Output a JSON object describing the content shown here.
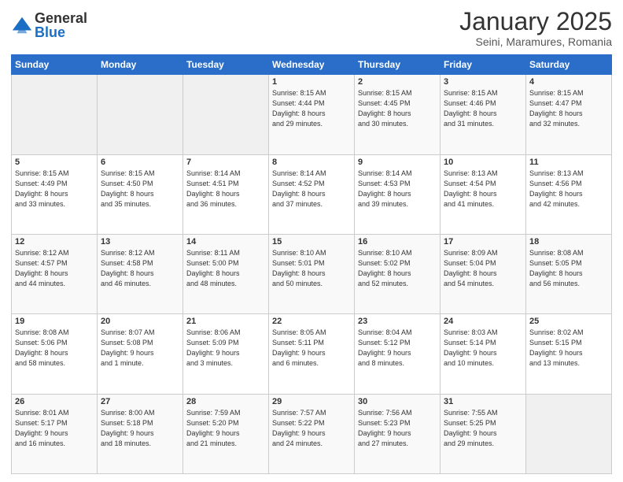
{
  "header": {
    "logo_general": "General",
    "logo_blue": "Blue",
    "month_title": "January 2025",
    "location": "Seini, Maramures, Romania"
  },
  "weekdays": [
    "Sunday",
    "Monday",
    "Tuesday",
    "Wednesday",
    "Thursday",
    "Friday",
    "Saturday"
  ],
  "weeks": [
    [
      {
        "day": "",
        "info": ""
      },
      {
        "day": "",
        "info": ""
      },
      {
        "day": "",
        "info": ""
      },
      {
        "day": "1",
        "info": "Sunrise: 8:15 AM\nSunset: 4:44 PM\nDaylight: 8 hours\nand 29 minutes."
      },
      {
        "day": "2",
        "info": "Sunrise: 8:15 AM\nSunset: 4:45 PM\nDaylight: 8 hours\nand 30 minutes."
      },
      {
        "day": "3",
        "info": "Sunrise: 8:15 AM\nSunset: 4:46 PM\nDaylight: 8 hours\nand 31 minutes."
      },
      {
        "day": "4",
        "info": "Sunrise: 8:15 AM\nSunset: 4:47 PM\nDaylight: 8 hours\nand 32 minutes."
      }
    ],
    [
      {
        "day": "5",
        "info": "Sunrise: 8:15 AM\nSunset: 4:49 PM\nDaylight: 8 hours\nand 33 minutes."
      },
      {
        "day": "6",
        "info": "Sunrise: 8:15 AM\nSunset: 4:50 PM\nDaylight: 8 hours\nand 35 minutes."
      },
      {
        "day": "7",
        "info": "Sunrise: 8:14 AM\nSunset: 4:51 PM\nDaylight: 8 hours\nand 36 minutes."
      },
      {
        "day": "8",
        "info": "Sunrise: 8:14 AM\nSunset: 4:52 PM\nDaylight: 8 hours\nand 37 minutes."
      },
      {
        "day": "9",
        "info": "Sunrise: 8:14 AM\nSunset: 4:53 PM\nDaylight: 8 hours\nand 39 minutes."
      },
      {
        "day": "10",
        "info": "Sunrise: 8:13 AM\nSunset: 4:54 PM\nDaylight: 8 hours\nand 41 minutes."
      },
      {
        "day": "11",
        "info": "Sunrise: 8:13 AM\nSunset: 4:56 PM\nDaylight: 8 hours\nand 42 minutes."
      }
    ],
    [
      {
        "day": "12",
        "info": "Sunrise: 8:12 AM\nSunset: 4:57 PM\nDaylight: 8 hours\nand 44 minutes."
      },
      {
        "day": "13",
        "info": "Sunrise: 8:12 AM\nSunset: 4:58 PM\nDaylight: 8 hours\nand 46 minutes."
      },
      {
        "day": "14",
        "info": "Sunrise: 8:11 AM\nSunset: 5:00 PM\nDaylight: 8 hours\nand 48 minutes."
      },
      {
        "day": "15",
        "info": "Sunrise: 8:10 AM\nSunset: 5:01 PM\nDaylight: 8 hours\nand 50 minutes."
      },
      {
        "day": "16",
        "info": "Sunrise: 8:10 AM\nSunset: 5:02 PM\nDaylight: 8 hours\nand 52 minutes."
      },
      {
        "day": "17",
        "info": "Sunrise: 8:09 AM\nSunset: 5:04 PM\nDaylight: 8 hours\nand 54 minutes."
      },
      {
        "day": "18",
        "info": "Sunrise: 8:08 AM\nSunset: 5:05 PM\nDaylight: 8 hours\nand 56 minutes."
      }
    ],
    [
      {
        "day": "19",
        "info": "Sunrise: 8:08 AM\nSunset: 5:06 PM\nDaylight: 8 hours\nand 58 minutes."
      },
      {
        "day": "20",
        "info": "Sunrise: 8:07 AM\nSunset: 5:08 PM\nDaylight: 9 hours\nand 1 minute."
      },
      {
        "day": "21",
        "info": "Sunrise: 8:06 AM\nSunset: 5:09 PM\nDaylight: 9 hours\nand 3 minutes."
      },
      {
        "day": "22",
        "info": "Sunrise: 8:05 AM\nSunset: 5:11 PM\nDaylight: 9 hours\nand 6 minutes."
      },
      {
        "day": "23",
        "info": "Sunrise: 8:04 AM\nSunset: 5:12 PM\nDaylight: 9 hours\nand 8 minutes."
      },
      {
        "day": "24",
        "info": "Sunrise: 8:03 AM\nSunset: 5:14 PM\nDaylight: 9 hours\nand 10 minutes."
      },
      {
        "day": "25",
        "info": "Sunrise: 8:02 AM\nSunset: 5:15 PM\nDaylight: 9 hours\nand 13 minutes."
      }
    ],
    [
      {
        "day": "26",
        "info": "Sunrise: 8:01 AM\nSunset: 5:17 PM\nDaylight: 9 hours\nand 16 minutes."
      },
      {
        "day": "27",
        "info": "Sunrise: 8:00 AM\nSunset: 5:18 PM\nDaylight: 9 hours\nand 18 minutes."
      },
      {
        "day": "28",
        "info": "Sunrise: 7:59 AM\nSunset: 5:20 PM\nDaylight: 9 hours\nand 21 minutes."
      },
      {
        "day": "29",
        "info": "Sunrise: 7:57 AM\nSunset: 5:22 PM\nDaylight: 9 hours\nand 24 minutes."
      },
      {
        "day": "30",
        "info": "Sunrise: 7:56 AM\nSunset: 5:23 PM\nDaylight: 9 hours\nand 27 minutes."
      },
      {
        "day": "31",
        "info": "Sunrise: 7:55 AM\nSunset: 5:25 PM\nDaylight: 9 hours\nand 29 minutes."
      },
      {
        "day": "",
        "info": ""
      }
    ]
  ]
}
